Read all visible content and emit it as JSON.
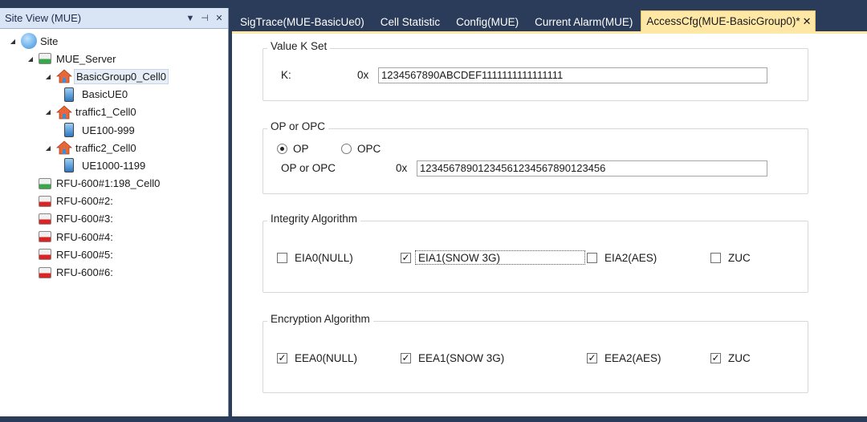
{
  "left_panel": {
    "title": "Site View (MUE)",
    "dropdown_icon": "chevron-down-icon",
    "pin_icon": "pin-icon",
    "close_icon": "close-icon",
    "tree": [
      {
        "label": "Site",
        "icon": "site-icon",
        "level": 0,
        "expander": "expanded"
      },
      {
        "label": "MUE_Server",
        "icon": "server-icon",
        "level": 1,
        "expander": "expanded"
      },
      {
        "label": "BasicGroup0_Cell0",
        "icon": "cell-home-icon",
        "level": 2,
        "expander": "expanded",
        "selected": true
      },
      {
        "label": "BasicUE0",
        "icon": "phone-icon",
        "level": 3
      },
      {
        "label": "traffic1_Cell0",
        "icon": "cell-home-icon",
        "level": 2,
        "expander": "expanded"
      },
      {
        "label": "UE100-999",
        "icon": "phone-icon",
        "level": 3
      },
      {
        "label": "traffic2_Cell0",
        "icon": "cell-home-icon",
        "level": 2,
        "expander": "expanded"
      },
      {
        "label": "UE1000-1199",
        "icon": "phone-icon",
        "level": 3
      },
      {
        "label": "RFU-600#1:198_Cell0",
        "icon": "rfu-green-icon",
        "level": 1
      },
      {
        "label": "RFU-600#2:",
        "icon": "rfu-red-icon",
        "level": 1
      },
      {
        "label": "RFU-600#3:",
        "icon": "rfu-red-icon",
        "level": 1
      },
      {
        "label": "RFU-600#4:",
        "icon": "rfu-red-icon",
        "level": 1
      },
      {
        "label": "RFU-600#5:",
        "icon": "rfu-red-icon",
        "level": 1
      },
      {
        "label": "RFU-600#6:",
        "icon": "rfu-red-icon",
        "level": 1
      }
    ]
  },
  "tabs": [
    {
      "label": "SigTrace(MUE-BasicUe0)",
      "active": false
    },
    {
      "label": "Cell Statistic",
      "active": false
    },
    {
      "label": "Config(MUE)",
      "active": false
    },
    {
      "label": "Current Alarm(MUE)",
      "active": false
    },
    {
      "label": "AccessCfg(MUE-BasicGroup0)*",
      "active": true,
      "close": "✕"
    }
  ],
  "value_k_set": {
    "title": "Value K Set",
    "k_label": "K:",
    "prefix": "0x",
    "k_value": "1234567890ABCDEF1111111111111111"
  },
  "op_opc": {
    "title": "OP or OPC",
    "radio_op": "OP",
    "radio_opc": "OPC",
    "selected": "OP",
    "field_label": "OP or OPC",
    "prefix": "0x",
    "value": "12345678901234561234567890123456"
  },
  "integrity": {
    "title": "Integrity Algorithm",
    "options": [
      {
        "label": "EIA0(NULL)",
        "checked": false
      },
      {
        "label": "EIA1(SNOW 3G)",
        "checked": true,
        "focused": true
      },
      {
        "label": "EIA2(AES)",
        "checked": false
      },
      {
        "label": "ZUC",
        "checked": false
      }
    ]
  },
  "encryption": {
    "title": "Encryption Algorithm",
    "options": [
      {
        "label": "EEA0(NULL)",
        "checked": true
      },
      {
        "label": "EEA1(SNOW 3G)",
        "checked": true
      },
      {
        "label": "EEA2(AES)",
        "checked": true
      },
      {
        "label": "ZUC",
        "checked": true
      }
    ]
  },
  "colors": {
    "active_tab": "#ffe8a6",
    "frame": "#2b3b5a",
    "panel_header": "#d9e4f5"
  }
}
